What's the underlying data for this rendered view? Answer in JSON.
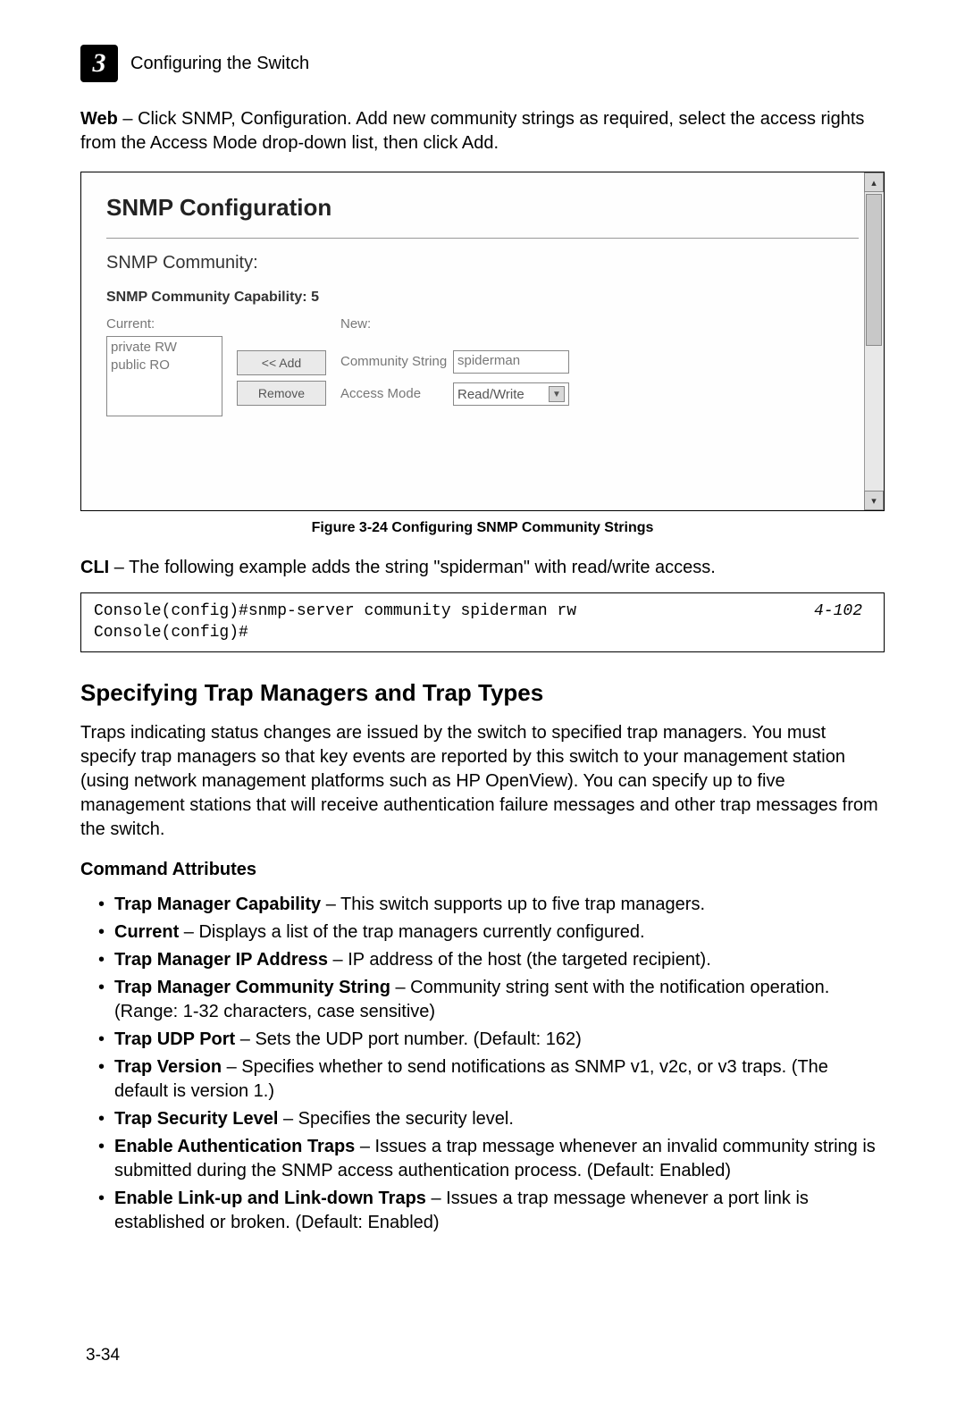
{
  "header": {
    "chapter_number": "3",
    "chapter_title": "Configuring the Switch"
  },
  "intro": {
    "label": "Web",
    "text": " – Click SNMP, Configuration. Add new community strings as required, select the access rights from the Access Mode drop-down list, then click Add."
  },
  "screenshot": {
    "title": "SNMP Configuration",
    "community_label": "SNMP Community:",
    "capability_label": "SNMP Community Capability: 5",
    "current_label": "Current:",
    "new_label": "New:",
    "list_items": [
      "private RW",
      "public RO"
    ],
    "add_btn": "<< Add",
    "remove_btn": "Remove",
    "field1_label": "Community String",
    "field1_value": "spiderman",
    "field2_label": "Access Mode",
    "field2_value": "Read/Write"
  },
  "figure_caption": "Figure 3-24  Configuring SNMP Community Strings",
  "cli": {
    "label": "CLI",
    "text": " – The following example adds the string \"spiderman\" with read/write access."
  },
  "code": {
    "line1": "Console(config)#snmp-server community spiderman rw",
    "line2": "Console(config)#",
    "ref": "4-102"
  },
  "section": {
    "heading": "Specifying Trap Managers and Trap Types",
    "para": "Traps indicating status changes are issued by the switch to specified trap managers. You must specify trap managers so that key events are reported by this switch to your management station (using network management platforms such as HP OpenView). You can specify up to five management stations that will receive authentication failure messages and other trap messages from the switch.",
    "cmd_attr": "Command Attributes",
    "attrs": [
      {
        "b": "Trap Manager Capability",
        "t": " – This switch supports up to five trap managers."
      },
      {
        "b": "Current",
        "t": " – Displays a list of the trap managers currently configured."
      },
      {
        "b": "Trap Manager IP Address",
        "t": " – IP address of the host (the targeted recipient)."
      },
      {
        "b": "Trap Manager Community String",
        "t": " – Community string sent with the notification operation. (Range: 1-32 characters, case sensitive)"
      },
      {
        "b": "Trap UDP Port",
        "t": " – Sets the UDP port number. (Default: 162)"
      },
      {
        "b": "Trap Version",
        "t": " – Specifies whether to send notifications as SNMP v1, v2c, or v3 traps. (The default is version 1.)"
      },
      {
        "b": "Trap Security Level",
        "t": " – Specifies the security level."
      },
      {
        "b": "Enable Authentication Traps",
        "t": " – Issues a trap message whenever an invalid community string is submitted during the SNMP access authentication process. (Default: Enabled)"
      },
      {
        "b": "Enable Link-up and Link-down Traps",
        "t": " – Issues a trap message whenever a port link is established or broken. (Default: Enabled)"
      }
    ]
  },
  "page_number": "3-34"
}
